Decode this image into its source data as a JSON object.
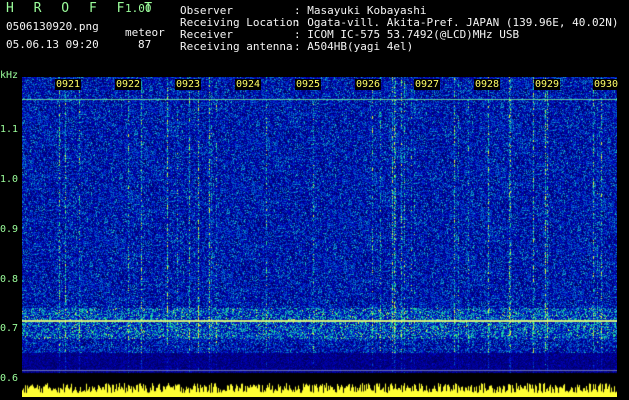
{
  "header": {
    "app_name": "H R O F F T",
    "version": "1.00",
    "filename": "0506130920.png",
    "mode": "meteor",
    "datetime": "05.06.13 09:20",
    "count": "87",
    "info": [
      {
        "label": "Observer",
        "value": ": Masayuki Kobayashi"
      },
      {
        "label": "Receiving Location",
        "value": ": Ogata-vill. Akita-Pref. JAPAN (139.96E, 40.02N)"
      },
      {
        "label": "Receiver",
        "value": ": ICOM IC-575 53.7492(@LCD)MHz USB"
      },
      {
        "label": "Receiving antenna",
        "value": ": A504HB(yagi 4el)"
      }
    ]
  },
  "spectrogram": {
    "y_unit": "kHz",
    "y_ticks": [
      "1.1",
      "1.0",
      "0.9",
      "0.8",
      "0.7",
      "0.6"
    ],
    "x_ticks": [
      "0921",
      "0922",
      "0923",
      "0924",
      "0925",
      "0926",
      "0927",
      "0928",
      "0929",
      "0930"
    ],
    "colors": {
      "background": "#000000",
      "label": "#9cff9c",
      "time_label": "#ffff66"
    }
  }
}
